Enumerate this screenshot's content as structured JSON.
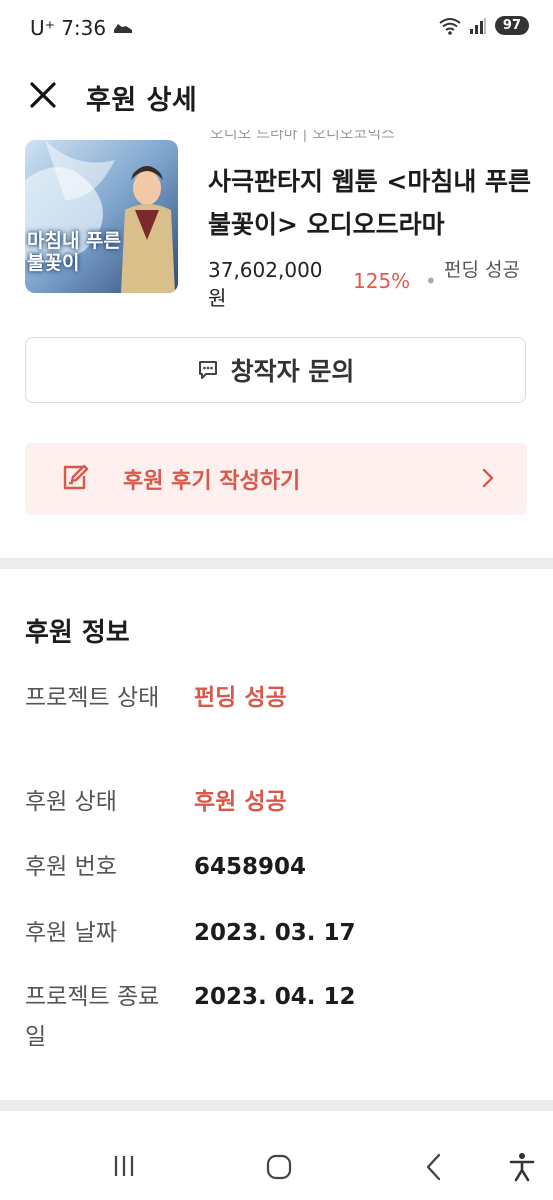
{
  "status_bar": {
    "carrier": "U⁺",
    "time": "7:36",
    "battery": "97"
  },
  "header": {
    "title": "후원 상세"
  },
  "project": {
    "cropped_top_text": "오디오 드라마 | 오디오코믹스",
    "title": "사극판타지 웹툰 <마침내 푸른 불꽃이> 오디오드라마",
    "thumbnail_text": "마침내 푸른 불꽃이",
    "amount": "37,602,000원",
    "percent": "125%",
    "separator": "•",
    "status": "펀딩 성공"
  },
  "inquiry_button": {
    "label": "창작자 문의"
  },
  "review_button": {
    "label": "후원 후기 작성하기"
  },
  "sponsorship_info": {
    "title": "후원 정보",
    "rows": [
      {
        "label": "프로젝트 상태",
        "value": "펀딩 성공"
      },
      {
        "label": "후원 상태",
        "value": "후원 성공"
      },
      {
        "label": "후원 번호",
        "value": "6458904"
      },
      {
        "label": "후원 날짜",
        "value": "2023. 03. 17"
      },
      {
        "label": "프로젝트 종료일",
        "value": "2023. 04. 12"
      }
    ]
  },
  "colors": {
    "accent": "#d9584a",
    "review_bg": "#fdf0ee",
    "divider": "#ececec"
  },
  "icons": {
    "close": "close-icon",
    "chat": "chat-icon",
    "edit": "edit-icon",
    "chevron": "chevron-right-icon",
    "nav_recent": "recent-apps-icon",
    "nav_home": "home-icon",
    "nav_back": "back-icon",
    "nav_accessibility": "accessibility-icon"
  }
}
